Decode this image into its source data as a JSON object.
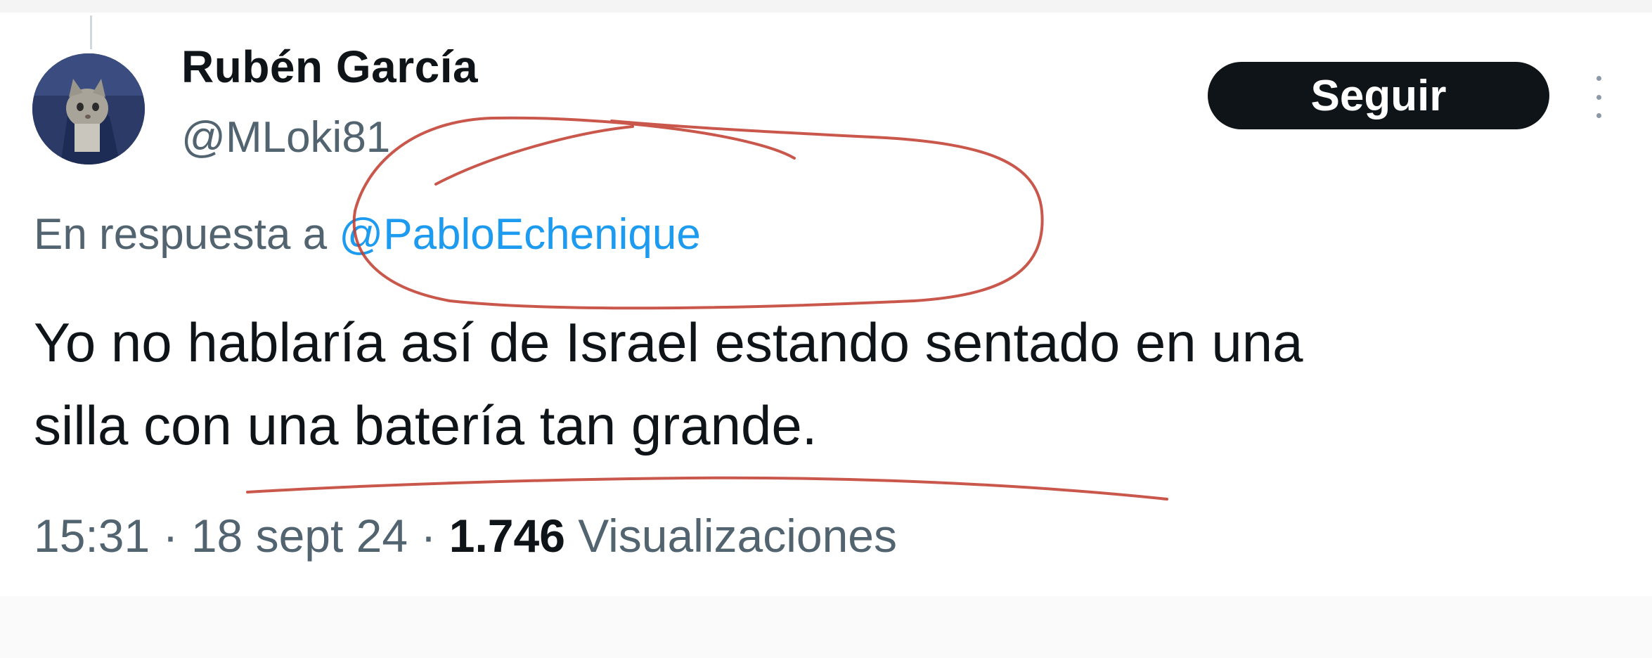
{
  "tweet": {
    "author": {
      "display_name": "Rubén García",
      "handle": "@MLoki81",
      "avatar_icon": "cat-avatar"
    },
    "follow_label": "Seguir",
    "more_icon": "more-vertical-icon",
    "reply_to": {
      "prefix": "En respuesta a",
      "handle": "@PabloEchenique"
    },
    "text_line_1": "Yo no hablaría así de Israel estando sentado en una",
    "text_line_2": "silla con una batería tan grande.",
    "time": "15:31",
    "date": "18 sept 24",
    "views_count": "1.746",
    "views_label": "Visualizaciones",
    "separator": "·"
  },
  "colors": {
    "text_primary": "#0f1419",
    "text_secondary": "#536471",
    "link": "#1d9bf0",
    "button_bg": "#0f1419",
    "annotation_red": "#c0392b"
  }
}
